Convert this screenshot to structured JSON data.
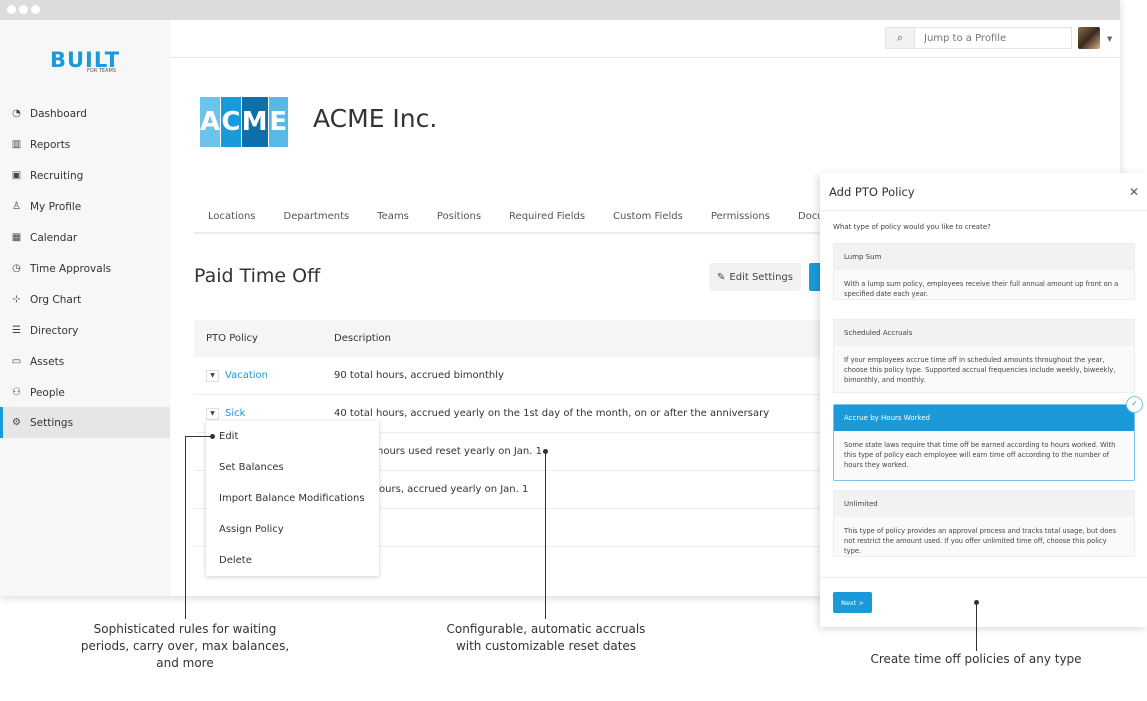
{
  "brand": {
    "logo": "BUILT",
    "tagline": "FOR TEAMS",
    "accent": "#1a9ad9"
  },
  "sidebar": {
    "items": [
      {
        "label": "Dashboard",
        "icon": "dashboard-icon"
      },
      {
        "label": "Reports",
        "icon": "bar-chart-icon"
      },
      {
        "label": "Recruiting",
        "icon": "briefcase-icon"
      },
      {
        "label": "My Profile",
        "icon": "user-icon"
      },
      {
        "label": "Calendar",
        "icon": "calendar-icon"
      },
      {
        "label": "Time Approvals",
        "icon": "clock-icon"
      },
      {
        "label": "Org Chart",
        "icon": "org-chart-icon"
      },
      {
        "label": "Directory",
        "icon": "list-icon"
      },
      {
        "label": "Assets",
        "icon": "monitor-icon"
      },
      {
        "label": "People",
        "icon": "people-icon"
      },
      {
        "label": "Settings",
        "icon": "gear-icon",
        "active": true
      }
    ]
  },
  "header": {
    "search_placeholder": "Jump to a Profile"
  },
  "company": {
    "logo_letters": [
      "A",
      "C",
      "M",
      "E"
    ],
    "name": "ACME Inc."
  },
  "tabs": [
    "Locations",
    "Departments",
    "Teams",
    "Positions",
    "Required Fields",
    "Custom Fields",
    "Permissions",
    "Documen"
  ],
  "page": {
    "title": "Paid Time Off",
    "edit_settings": "Edit Settings"
  },
  "table": {
    "headers": [
      "PTO Policy",
      "Description"
    ],
    "rows": [
      {
        "policy": "Vacation",
        "description": "90 total hours, accrued bimonthly"
      },
      {
        "policy": "Sick",
        "description": "40 total hours, accrued yearly on the 1st day of the month, on or after the anniversary"
      },
      {
        "policy": "",
        "description": "hours used reset yearly on Jan. 1"
      },
      {
        "policy": "",
        "description": "ours, accrued yearly on Jan. 1"
      },
      {
        "policy": "",
        "description": ""
      }
    ]
  },
  "menu": [
    "Edit",
    "Set Balances",
    "Import Balance Modifications",
    "Assign Policy",
    "Delete"
  ],
  "modal": {
    "title": "Add PTO Policy",
    "question": "What type of policy would you like to create?",
    "options": [
      {
        "title": "Lump Sum",
        "body": "With a lump sum policy, employees receive their full annual amount up front on a specified date each year."
      },
      {
        "title": "Scheduled Accruals",
        "body": "If your employees accrue time off in scheduled amounts throughout the year, choose this policy type. Supported accrual frequencies include weekly, biweekly, bimonthly, and monthly."
      },
      {
        "title": "Accrue by Hours Worked",
        "body": "Some state laws require that time off be earned according to hours worked. With this type of policy each employee will earn time off according to the number of hours they worked.",
        "selected": true
      },
      {
        "title": "Unlimited",
        "body": "This type of policy provides an approval process and tracks total usage, but does not restrict the amount used. If you offer unlimited time off, choose this policy type."
      }
    ],
    "next": "Next >"
  },
  "callouts": [
    "Sophisticated rules for waiting periods, carry over, max balances, and more",
    "Configurable, automatic accruals with customizable reset dates",
    "Create time off policies of any type"
  ]
}
